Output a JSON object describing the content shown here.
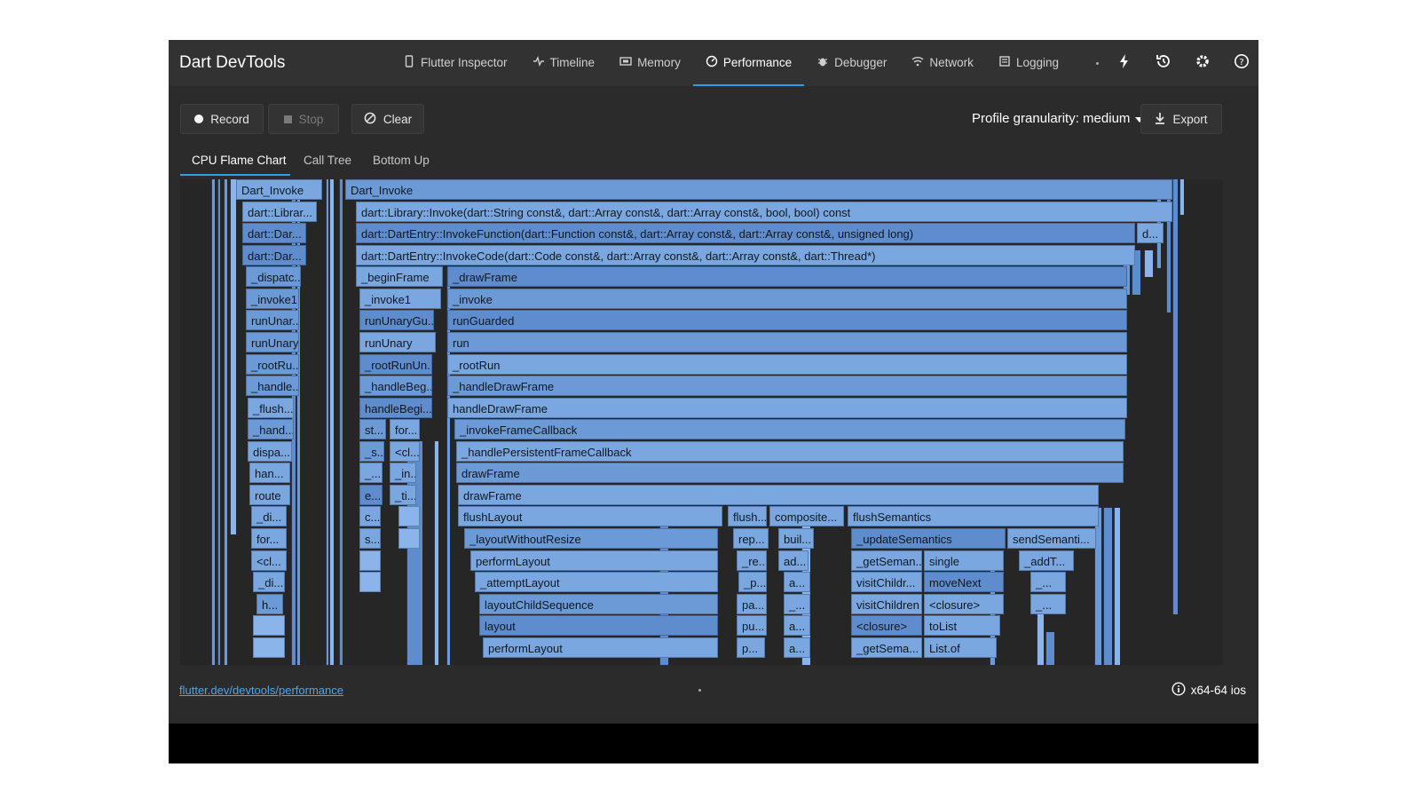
{
  "header": {
    "title": "Dart DevTools",
    "tabs": [
      {
        "label": "Flutter Inspector",
        "icon": "phone-icon"
      },
      {
        "label": "Timeline",
        "icon": "pulse-icon"
      },
      {
        "label": "Memory",
        "icon": "memory-icon"
      },
      {
        "label": "Performance",
        "icon": "speedometer-icon",
        "active": true
      },
      {
        "label": "Debugger",
        "icon": "bug-icon"
      },
      {
        "label": "Network",
        "icon": "wifi-icon"
      },
      {
        "label": "Logging",
        "icon": "log-icon"
      }
    ],
    "actions": [
      "bolt-icon",
      "history-icon",
      "gear-icon",
      "help-icon"
    ]
  },
  "toolbar": {
    "record": "Record",
    "stop": "Stop",
    "clear": "Clear",
    "granularity": "Profile granularity: medium",
    "export": "Export"
  },
  "subtabs": [
    "CPU Flame Chart",
    "Call Tree",
    "Bottom Up"
  ],
  "flame": [
    "Dart_Invoke",
    "dart::Librar...",
    "dart::Dar...",
    "dart::Dar...",
    "_dispatc...",
    "_invoke1",
    "runUnar...",
    "runUnary",
    "_rootRu...",
    "_handle...",
    "_flush...",
    "_hand...",
    "dispa...",
    "han...",
    "route",
    "_di...",
    "for...",
    "<cl...",
    "_di...",
    "h...",
    "Dart_Invoke",
    "dart::Library::Invoke(dart::String const&, dart::Array const&, dart::Array const&, bool, bool) const",
    "dart::DartEntry::InvokeFunction(dart::Function const&, dart::Array const&, dart::Array const&, unsigned long)",
    "d...",
    "dart::DartEntry::InvokeCode(dart::Code const&, dart::Array const&, dart::Array const&, dart::Thread*)",
    "_beginFrame",
    "_invoke1",
    "runUnaryGu...",
    "runUnary",
    "_rootRunUn...",
    "_handleBeg...",
    "handleBegi...",
    "st...",
    "for...",
    "_s...",
    "<cl...",
    "_...",
    "_in...",
    "e...",
    "_ti...",
    "c...",
    "s...",
    "_drawFrame",
    "_invoke",
    "runGuarded",
    "run",
    "_rootRun",
    "_handleDrawFrame",
    "handleDrawFrame",
    "_invokeFrameCallback",
    "_handlePersistentFrameCallback",
    "drawFrame",
    "drawFrame",
    "flushLayout",
    "_layoutWithoutResize",
    "performLayout",
    "_attemptLayout",
    "layoutChildSequence",
    "layout",
    "performLayout",
    "flush...",
    "rep...",
    "_re...",
    "_p...",
    "pa...",
    "pu...",
    "p...",
    "composite...",
    "buil...",
    "ad...",
    "a...",
    "_...",
    "a...",
    "a...",
    "flushSemantics",
    "_updateSemantics",
    "_getSeman...",
    "visitChildr...",
    "visitChildren",
    "<closure>",
    "_getSema...",
    "single",
    "moveNext",
    "<closure>",
    "toList",
    "List.of",
    "sendSemanti...",
    "_addT...",
    "_...",
    "_..."
  ],
  "footer": {
    "link": "flutter.dev/devtools/performance",
    "platform": "x64-64 ios"
  }
}
